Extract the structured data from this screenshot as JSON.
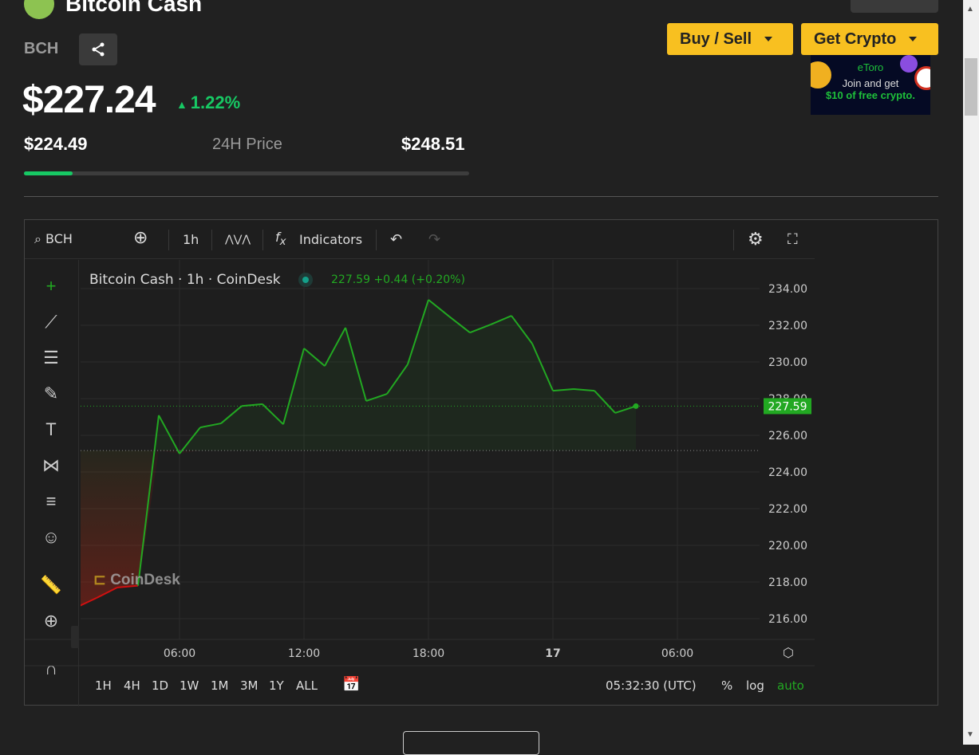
{
  "header": {
    "title": "Bitcoin Cash",
    "symbol": "BCH",
    "price": "$227.24",
    "change": "1.22%",
    "low": "$224.49",
    "high": "$248.51",
    "range_label": "24H Price",
    "range_position": 0.11
  },
  "actions": {
    "buy_sell": "Buy / Sell",
    "get_crypto": "Get Crypto"
  },
  "ad": {
    "brand": "eToro",
    "line1": "Join and get",
    "line2": "$10 of free crypto."
  },
  "toolbar": {
    "symbol": "BCH",
    "interval": "1h",
    "indicators": "Indicators"
  },
  "legend": {
    "title": "Bitcoin Cash · 1h · CoinDesk",
    "last": "227.59",
    "change": "+0.44 (+0.20%)"
  },
  "watermark": "CoinDesk",
  "ranges": [
    "1H",
    "4H",
    "1D",
    "1W",
    "1M",
    "3M",
    "1Y",
    "ALL"
  ],
  "clock": "05:32:30 (UTC)",
  "scale": {
    "pct": "%",
    "log": "log",
    "auto": "auto"
  },
  "colors": {
    "up": "#22a822",
    "down": "#d01010",
    "accent": "#f8c020",
    "positive": "#17c964"
  },
  "chart_data": {
    "type": "line",
    "title": "Bitcoin Cash · 1h · CoinDesk",
    "x": [
      "01:00",
      "02:00",
      "03:00",
      "04:00",
      "05:00",
      "06:00",
      "07:00",
      "08:00",
      "09:00",
      "10:00",
      "11:00",
      "12:00",
      "13:00",
      "14:00",
      "15:00",
      "16:00",
      "17:00",
      "18:00",
      "19:00",
      "20:00",
      "21:00",
      "22:00",
      "23:00",
      "00:00",
      "01:00",
      "02:00",
      "03:00",
      "04:00"
    ],
    "values": [
      216.6,
      217.13,
      217.7,
      217.8,
      227.09,
      225.0,
      226.43,
      226.65,
      227.6,
      227.7,
      226.6,
      230.74,
      229.78,
      231.87,
      227.87,
      228.26,
      229.87,
      233.39,
      232.48,
      231.6,
      232.04,
      232.52,
      231.0,
      228.43,
      228.52,
      228.43,
      227.22,
      227.59
    ],
    "baseline": 225.17,
    "last_value_label": "227.59",
    "y_ticks": [
      "234.00",
      "232.00",
      "230.00",
      "228.00",
      "226.00",
      "224.00",
      "222.00",
      "220.00",
      "218.00",
      "216.00"
    ],
    "x_ticks": [
      "06:00",
      "12:00",
      "18:00",
      "17",
      "06:00"
    ],
    "ylim": [
      215.2,
      235.3
    ],
    "grid": true
  }
}
